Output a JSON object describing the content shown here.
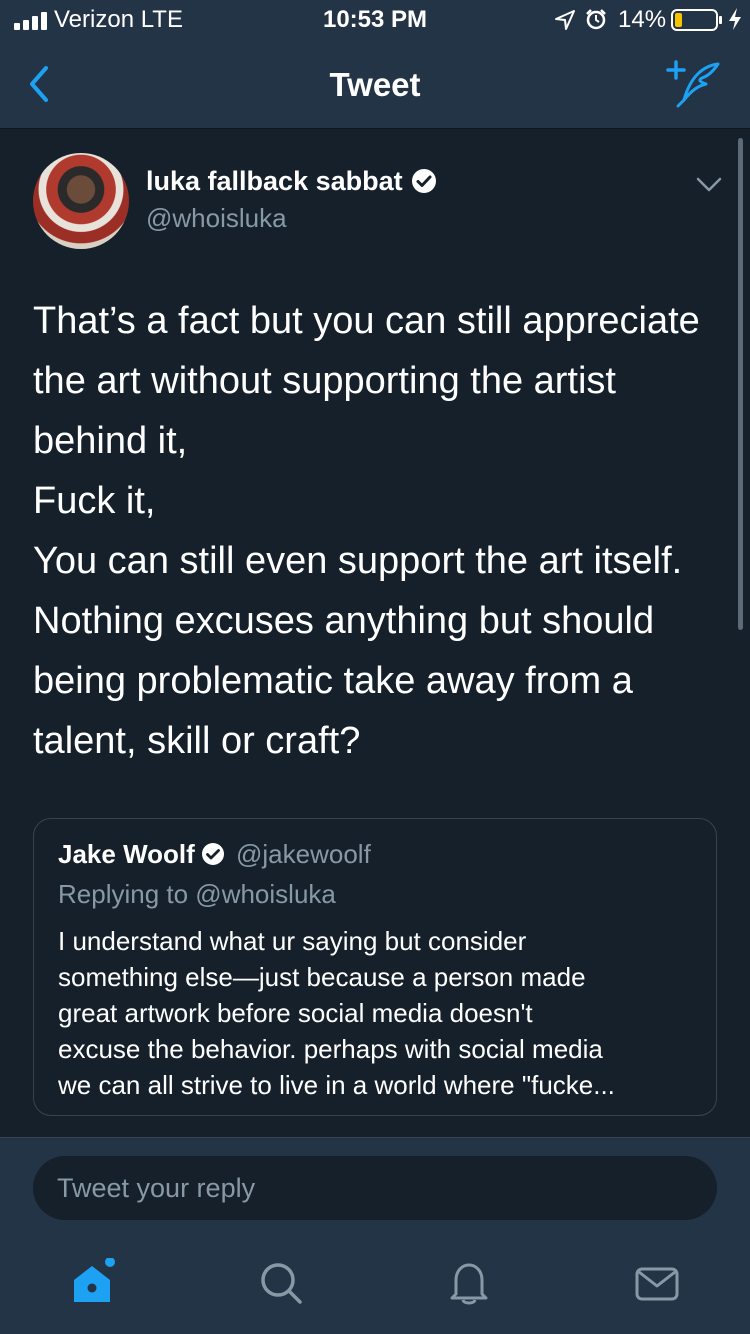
{
  "status_bar": {
    "carrier": "Verizon  LTE",
    "time": "10:53 PM",
    "battery": "14%"
  },
  "nav": {
    "title": "Tweet"
  },
  "tweet": {
    "author_name": "luka fallback sabbat",
    "author_handle": "@whoisluka",
    "text_lines": [
      "That’s a fact but you can still appreciate",
      "the art without supporting the artist",
      "behind it,",
      "Fuck it,",
      "You can still even support the art itself.",
      "Nothing excuses anything but should",
      "being problematic take away from a",
      "talent, skill or craft?"
    ]
  },
  "quote": {
    "name": "Jake Woolf",
    "handle": "@jakewoolf",
    "replying": "Replying to @whoisluka",
    "text_lines": [
      "I understand what ur saying but consider",
      "something else—just because a person made",
      "great artwork before social media doesn't",
      "excuse the behavior. perhaps with social media",
      "we can all strive to live in a world where \"fucke..."
    ]
  },
  "reply": {
    "placeholder": "Tweet your reply"
  },
  "colors": {
    "background": "#15202b",
    "bar": "#243447",
    "accent": "#1da1f2",
    "secondary_text": "#8899a6",
    "battery_low": "#f5c400"
  },
  "tabs": [
    "home-icon",
    "search-icon",
    "notifications-icon",
    "messages-icon"
  ]
}
